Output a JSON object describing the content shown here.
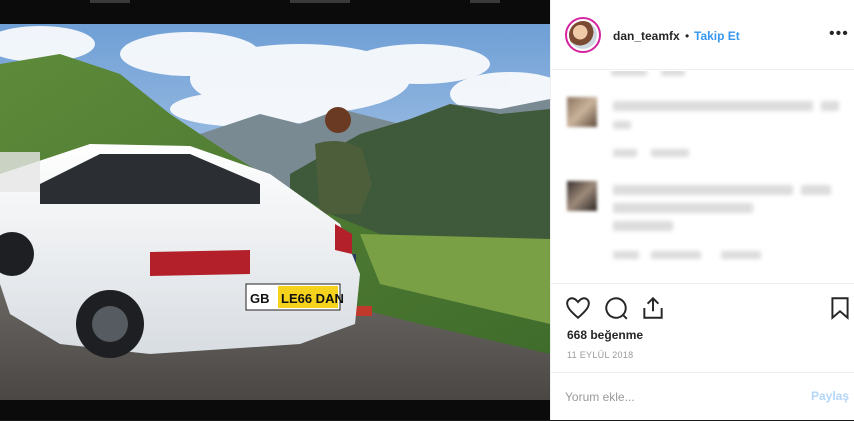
{
  "post": {
    "photo_subject": "",
    "license_plate_prefix": "GB",
    "license_plate": "LE66 DAN"
  },
  "header": {
    "username": "dan_teamfx",
    "separator": "•",
    "follow_label": "Takip Et",
    "more_label": "•••"
  },
  "actions": {
    "likes": "668 beğenme",
    "date": "11 EYLÜL 2018"
  },
  "comment": {
    "placeholder": "Yorum ekle...",
    "submit_label": "Paylaş"
  },
  "colors": {
    "accent": "#3897f0",
    "disabled_accent": "#b3d6f9",
    "text": "#262626",
    "muted": "#999999"
  },
  "icons": [
    "heart-icon",
    "comment-icon",
    "share-icon",
    "bookmark-icon",
    "more-icon"
  ]
}
